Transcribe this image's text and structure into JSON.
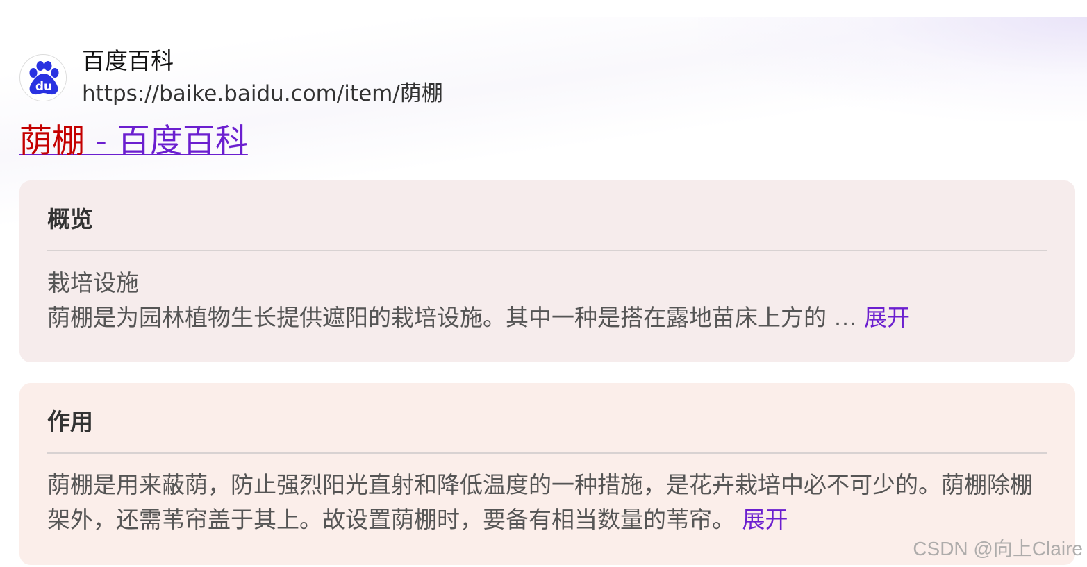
{
  "source": {
    "name": "百度百科",
    "url": "https://baike.baidu.com/item/荫棚",
    "logo_icon": "baidu-paw-icon",
    "logo_text": "du"
  },
  "result": {
    "title_highlight": "荫棚",
    "title_rest": " - 百度百科"
  },
  "overview": {
    "heading": "概览",
    "subtitle": "栽培设施",
    "text": "荫棚是为园林植物生长提供遮阳的栽培设施。其中一种是搭在露地苗床上方的 … ",
    "expand_label": "展开"
  },
  "function": {
    "heading": "作用",
    "text": "荫棚是用来蔽荫，防止强烈阳光直射和降低温度的一种措施，是花卉栽培中必不可少的。荫棚除棚架外，还需苇帘盖于其上。故设置荫棚时，要备有相当数量的苇帘。 ",
    "expand_label": "展开"
  },
  "watermark": "CSDN @向上Claire",
  "colors": {
    "link_visited": "#6b1fcf",
    "highlight_red": "#c40000",
    "overview_bg": "#f6ecec",
    "function_bg": "#fbeeea",
    "logo_blue": "#2932e1"
  }
}
